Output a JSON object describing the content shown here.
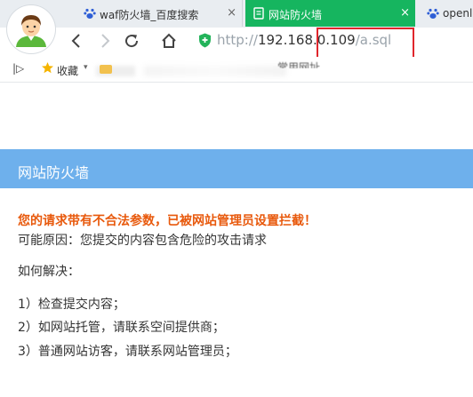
{
  "tabs": [
    {
      "label": "waf防火墙_百度搜索",
      "close": "×"
    },
    {
      "label": "网站防火墙",
      "close": "×"
    },
    {
      "label": "openl"
    }
  ],
  "address": {
    "scheme": "http://",
    "host": "192.168.0.109",
    "path": "/a.sql"
  },
  "bookmarks": {
    "toggle": "|▷",
    "favorites_label": "收藏",
    "caret": "▾",
    "partial_item": "常用网址"
  },
  "page": {
    "banner_title": "网站防火墙",
    "warning": "您的请求带有不合法参数，已被网站管理员设置拦截！",
    "reason": "可能原因：您提交的内容包含危险的攻击请求",
    "how_to": "如何解决：",
    "steps": [
      "1）检查提交内容；",
      "2）如网站托管，请联系空间提供商；",
      "3）普通网站访客，请联系网站管理员；"
    ]
  },
  "colors": {
    "active_tab": "#16b55f",
    "banner": "#6eb0ec",
    "warning_text": "#e8590c",
    "highlight_box": "#e0262c"
  },
  "icons": [
    "avatar",
    "baidu-paw-icon",
    "firewall-tab-icon",
    "back-icon",
    "forward-icon",
    "reload-icon",
    "home-icon",
    "secure-shield-icon",
    "star-icon",
    "folder-icon"
  ]
}
